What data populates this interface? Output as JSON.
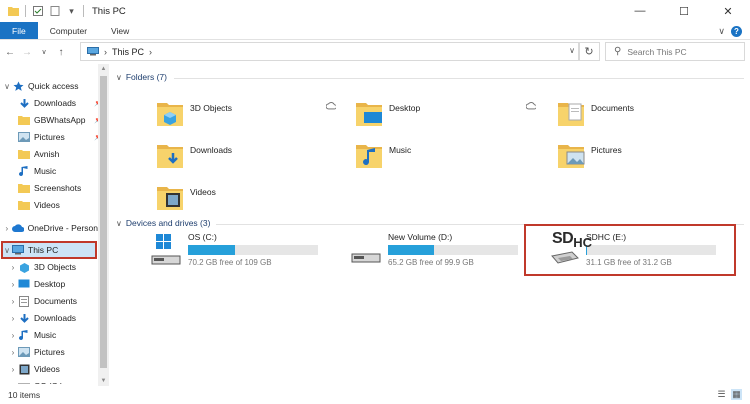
{
  "window": {
    "title": "This PC",
    "minimize_glyph": "—",
    "maximize_glyph": "☐",
    "close_glyph": "✕"
  },
  "ribbon": {
    "tabs": [
      {
        "label": "File",
        "active": true
      },
      {
        "label": "Computer",
        "active": false
      },
      {
        "label": "View",
        "active": false
      }
    ],
    "help_glyph": "?"
  },
  "address": {
    "crumb": "This PC",
    "separator": "›"
  },
  "search": {
    "placeholder": "Search This PC"
  },
  "sidebar": {
    "items": [
      {
        "label": "Quick access",
        "icon": "star-icon",
        "pinned": false,
        "expand": "∨"
      },
      {
        "label": "Downloads",
        "icon": "download-icon",
        "pinned": true,
        "expand": ""
      },
      {
        "label": "GBWhatsApp",
        "icon": "folder-icon",
        "pinned": true,
        "expand": ""
      },
      {
        "label": "Pictures",
        "icon": "pictures-icon",
        "pinned": true,
        "expand": ""
      },
      {
        "label": "Avnish",
        "icon": "folder-icon",
        "pinned": false,
        "expand": ""
      },
      {
        "label": "Music",
        "icon": "music-icon",
        "pinned": false,
        "expand": ""
      },
      {
        "label": "Screenshots",
        "icon": "folder-icon",
        "pinned": false,
        "expand": ""
      },
      {
        "label": "Videos",
        "icon": "folder-icon",
        "pinned": false,
        "expand": ""
      },
      {
        "label": "OneDrive - Person",
        "icon": "cloud-icon",
        "pinned": false,
        "expand": "›"
      },
      {
        "label": "This PC",
        "icon": "pc-icon",
        "pinned": false,
        "expand": "∨",
        "selected": true
      },
      {
        "label": "3D Objects",
        "icon": "3d-objects-icon",
        "pinned": false,
        "expand": "›"
      },
      {
        "label": "Desktop",
        "icon": "desktop-icon",
        "pinned": false,
        "expand": "›"
      },
      {
        "label": "Documents",
        "icon": "documents-icon",
        "pinned": false,
        "expand": "›"
      },
      {
        "label": "Downloads",
        "icon": "download-icon",
        "pinned": false,
        "expand": "›"
      },
      {
        "label": "Music",
        "icon": "music-icon",
        "pinned": false,
        "expand": "›"
      },
      {
        "label": "Pictures",
        "icon": "pictures-icon",
        "pinned": false,
        "expand": "›"
      },
      {
        "label": "Videos",
        "icon": "videos-icon",
        "pinned": false,
        "expand": "›"
      },
      {
        "label": "OS (C:)",
        "icon": "drive-icon",
        "pinned": false,
        "expand": "›"
      }
    ]
  },
  "folders_group": {
    "header": "Folders (7)",
    "items": [
      {
        "label": "3D Objects",
        "icon": "3d-objects-folder-icon"
      },
      {
        "label": "Desktop",
        "icon": "desktop-folder-icon"
      },
      {
        "label": "Documents",
        "icon": "documents-folder-icon"
      },
      {
        "label": "Downloads",
        "icon": "downloads-folder-icon"
      },
      {
        "label": "Music",
        "icon": "music-folder-icon"
      },
      {
        "label": "Pictures",
        "icon": "pictures-folder-icon"
      },
      {
        "label": "Videos",
        "icon": "videos-folder-icon"
      }
    ]
  },
  "drives_group": {
    "header": "Devices and drives (3)",
    "items": [
      {
        "name": "OS (C:)",
        "free": "70.2 GB free of 109 GB",
        "used_fraction": 0.36,
        "icon": "windows-drive-icon"
      },
      {
        "name": "New Volume (D:)",
        "free": "65.2 GB free of 99.9 GB",
        "used_fraction": 0.35,
        "icon": "hard-drive-icon"
      },
      {
        "name": "SDHC (E:)",
        "free": "31.1 GB free of 31.2 GB",
        "used_fraction": 0.01,
        "icon": "sd-card-drive-icon",
        "logo_main": "SD",
        "logo_sub": "HC"
      }
    ]
  },
  "statusbar": {
    "count": "10 items"
  },
  "colors": {
    "accent": "#1a73c4",
    "bar_fill": "#26a0da",
    "highlight": "#c0392b",
    "folder_yellow": "#f3c955"
  }
}
